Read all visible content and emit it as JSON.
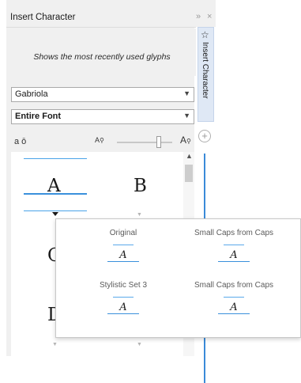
{
  "docker": {
    "title": "Insert Character",
    "controls": {
      "collapse": "»",
      "close": "×"
    },
    "side_tab_label": "Insert Character"
  },
  "recent": {
    "message": "Shows the most recently used glyphs"
  },
  "font_select": {
    "value": "Gabriola"
  },
  "filter_select": {
    "value": "Entire Font"
  },
  "toolbar": {
    "glyph_toggle": "a ō",
    "zoom_small": "A",
    "zoom_large": "A"
  },
  "grid": {
    "cells": [
      "A",
      "B",
      "C",
      "D"
    ]
  },
  "popup": {
    "alternates": [
      {
        "label": "Original",
        "glyph": "A"
      },
      {
        "label": "Small Caps from Caps",
        "glyph": "A"
      },
      {
        "label": "Stylistic Set 3",
        "glyph": "A"
      },
      {
        "label": "Small Caps from Caps",
        "glyph": "A"
      }
    ]
  },
  "colors": {
    "accent": "#3a8ad8",
    "panel_bg": "#f0f0f0"
  }
}
